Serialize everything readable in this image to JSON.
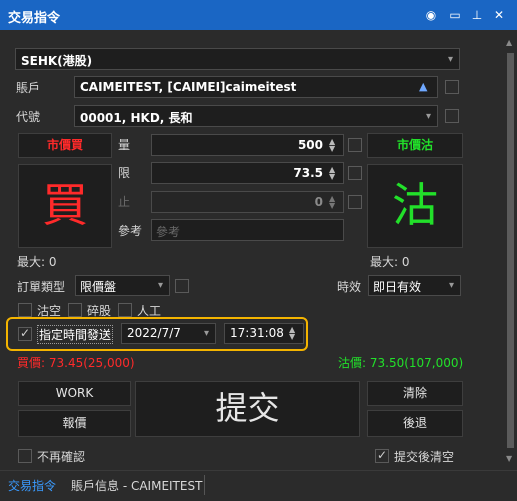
{
  "title": "交易指令",
  "market": "SEHK(港股)",
  "account": {
    "label": "賬戶",
    "value": "CAIMEITEST, [CAIMEI]caimeitest"
  },
  "code": {
    "label": "代號",
    "value": "00001, HKD, 長和"
  },
  "buttons": {
    "market_buy": "市價買",
    "market_sell": "市價沽",
    "big_buy": "買",
    "big_sell": "沽",
    "work": "WORK",
    "quote": "報價",
    "submit": "提交",
    "clear": "清除",
    "back": "後退"
  },
  "fields": {
    "qty_label": "量",
    "qty_value": "500",
    "limit_label": "限",
    "limit_value": "73.5",
    "stop_label": "止",
    "stop_value": "0",
    "ref_label": "參考",
    "ref_placeholder": "參考"
  },
  "max": {
    "buy": "最大: 0",
    "sell": "最大: 0"
  },
  "order_type": {
    "label": "訂單類型",
    "value": "限價盤"
  },
  "validity": {
    "label": "時效",
    "value": "即日有效"
  },
  "checks": {
    "short": "沽空",
    "odd_lot": "碎股",
    "manual": "人工",
    "timed_send": "指定時間發送",
    "no_confirm": "不再確認",
    "clear_after": "提交後清空"
  },
  "timed": {
    "date": "2022/7/7",
    "time": "17:31:08"
  },
  "prices": {
    "bid": "買價:  73.45(25,000)",
    "ask": "沽價:  73.50(107,000)"
  },
  "tabs": [
    "交易指令",
    "賬戶信息 - CAIMEITEST"
  ],
  "colors": {
    "buy": "#ff2a2a",
    "sell": "#22e02a",
    "accent": "#f4b400",
    "title_bar": "#1a66c4",
    "tab_active": "#3a9bff"
  }
}
